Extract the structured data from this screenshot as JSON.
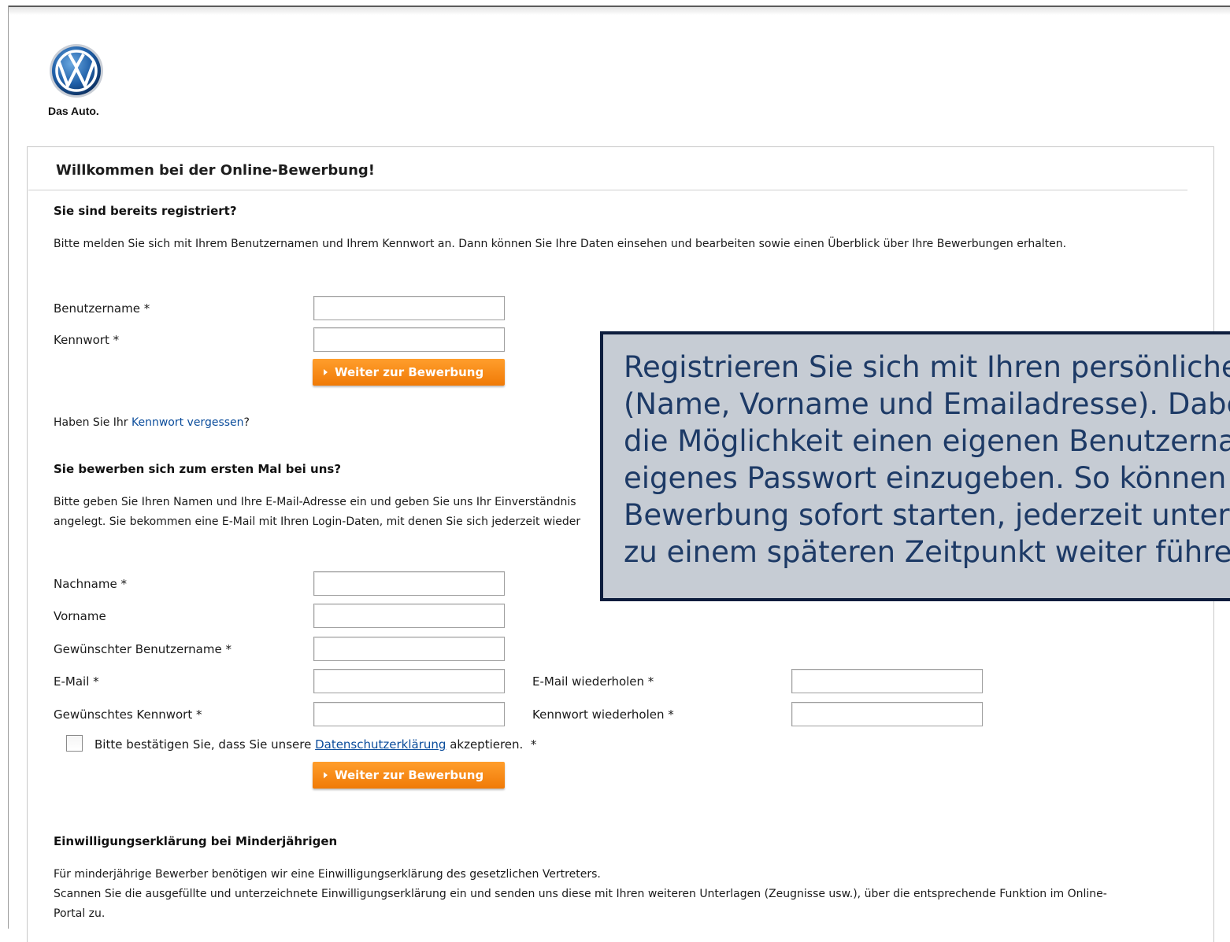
{
  "brand": {
    "logo_icon": "vw-logo-icon",
    "tagline": "Das Auto."
  },
  "page": {
    "title": "Willkommen bei der Online-Bewerbung!"
  },
  "login": {
    "heading": "Sie sind bereits registriert?",
    "intro": "Bitte melden Sie sich mit Ihrem Benutzernamen und Ihrem Kennwort an. Dann können Sie Ihre Daten einsehen und bearbeiten sowie einen Überblick über Ihre Bewerbungen erhalten.",
    "username_label": "Benutzername *",
    "password_label": "Kennwort *",
    "submit_label": "Weiter zur Bewerbung",
    "forgot_prefix": "Haben Sie Ihr ",
    "forgot_link": "Kennwort vergessen",
    "forgot_suffix": "?"
  },
  "register": {
    "heading": "Sie bewerben sich zum ersten Mal bei uns?",
    "intro_line1": "Bitte geben Sie Ihren Namen und Ihre E-Mail-Adresse ein und geben Sie uns Ihr Einverständnis",
    "intro_line2": "angelegt. Sie bekommen eine E-Mail mit Ihren Login-Daten, mit denen Sie sich jederzeit wieder",
    "lastname_label": "Nachname *",
    "firstname_label": "Vorname",
    "username_label": "Gewünschter Benutzername *",
    "email_label": "E-Mail *",
    "email_repeat_label": "E-Mail wiederholen *",
    "password_label": "Gewünschtes Kennwort *",
    "password_repeat_label": "Kennwort wiederholen *",
    "privacy_prefix": "Bitte bestätigen Sie, dass Sie unsere ",
    "privacy_link": "Datenschutzerklärung",
    "privacy_suffix": " akzeptieren.",
    "privacy_required": "*",
    "submit_label": "Weiter zur Bewerbung"
  },
  "minors": {
    "heading": "Einwilligungserklärung bei Minderjährigen",
    "line1": "Für minderjährige Bewerber benötigen wir eine Einwilligungserklärung des gesetzlichen Vertreters.",
    "line2": "Scannen Sie die ausgefüllte und unterzeichnete Einwilligungserklärung ein und senden uns diese mit Ihren weiteren Unterlagen (Zeugnisse usw.), über die entsprechende Funktion im Online-",
    "line3": "Portal zu."
  },
  "callout": {
    "text": "Registrieren Sie sich mit Ihren persönlichen\n(Name, Vorname und Emailadresse). Dabe\ndie Möglichkeit einen eigenen Benutzernar\neigenes Passwort einzugeben. So können S\nBewerbung sofort starten, jederzeit unterbr\nzu einem späteren Zeitpunkt weiter führen."
  }
}
